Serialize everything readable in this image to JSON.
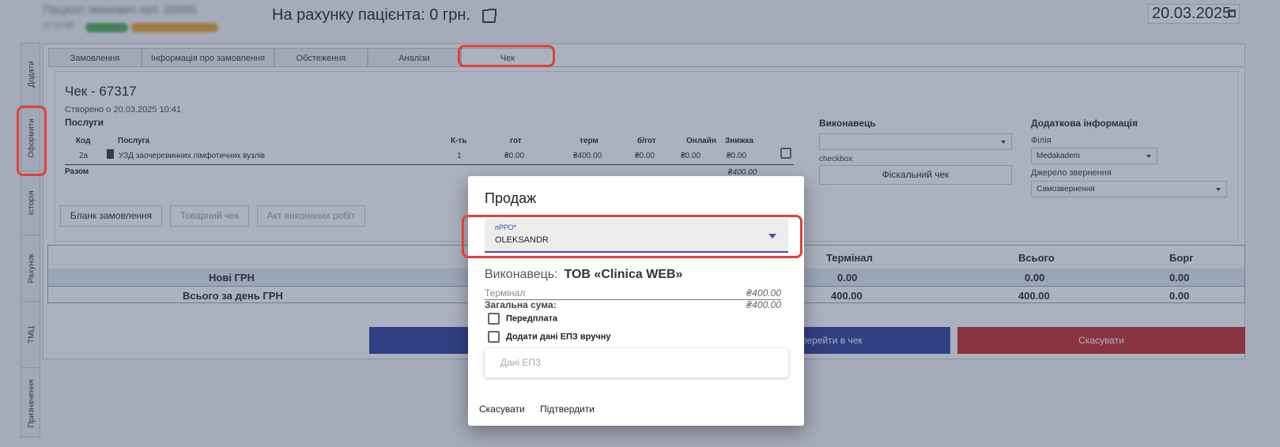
{
  "header": {
    "patient_name": "Пацієнт Іванович ерт. 20005",
    "patient_meta": "12.12.88",
    "balance_text": "На рахунку пацієнта: 0 грн.",
    "date": "20.03.2025"
  },
  "side_tabs": [
    "Додати",
    "Оформити",
    "Історія",
    "Рахунок",
    "ТМЦ",
    "Призначення"
  ],
  "tabs": [
    "Замовлення",
    "Інформація про замовлення",
    "Обстеження",
    "Аналізи",
    "Чек"
  ],
  "check": {
    "title": "Чек - 67317",
    "created": "Створено о 20.03.2025 10:41",
    "services_label": "Послуги",
    "headers": [
      "Код",
      "Послуга",
      "К-ть",
      "гот",
      "терм",
      "б/гот",
      "Онлайн",
      "Знижка"
    ],
    "row": {
      "code": "2а",
      "service": "УЗД заочеревинних лімфотичних вузлів",
      "qty": "1",
      "cash": "₴0.00",
      "term": "₴400.00",
      "noncash": "₴0.00",
      "online": "₴0.00",
      "discount": "₴0.00"
    },
    "total_label": "Разом",
    "total_value": "₴400.00",
    "buttons": [
      "Бланк замовлення",
      "Товарний чек",
      "Акт виконаних робіт"
    ]
  },
  "executor_panel": {
    "title": "Виконавець",
    "checkbox_label": "checkbox",
    "fiscal_button": "Фіскальний чек"
  },
  "extra_info": {
    "title": "Додаткова інформація",
    "branch_label": "Філія",
    "branch_value": "Medakadem",
    "source_label": "Джерело звернення",
    "source_value": "Самозвернення"
  },
  "totals": {
    "headers": [
      "Термінал",
      "Всього",
      "Борг"
    ],
    "rows": [
      {
        "label": "Нові ГРН",
        "terminal": "0.00",
        "total": "0.00",
        "debt": "0.00"
      },
      {
        "label": "Всього за день ГРН",
        "terminal": "400.00",
        "total": "400.00",
        "debt": "0.00"
      }
    ]
  },
  "bottom_buttons": {
    "go_to_check": "перейти в чек",
    "cancel": "Скасувати"
  },
  "dialog": {
    "title": "Продаж",
    "prro_label": "пРРО*",
    "prro_value": "OLEKSANDR",
    "executor_label": "Виконавець:",
    "executor_value": "ТОВ «Clinica WEB»",
    "terminal_label": "Термінал",
    "terminal_value": "₴400.00",
    "total_label": "Загальна сума:",
    "total_value": "₴400.00",
    "prepay_label": "Передплата",
    "manual_epz_label": "Додати дані ЕПЗ вручну",
    "epz_placeholder": "Дані ЕПЗ",
    "cancel_label": "Скасувати",
    "confirm_label": "Підтвердити"
  },
  "colors": {
    "highlight": "#e0413a",
    "primary_blue": "#2b3b97",
    "danger_red": "#c62828",
    "accent_indigo": "#3f51b5"
  }
}
